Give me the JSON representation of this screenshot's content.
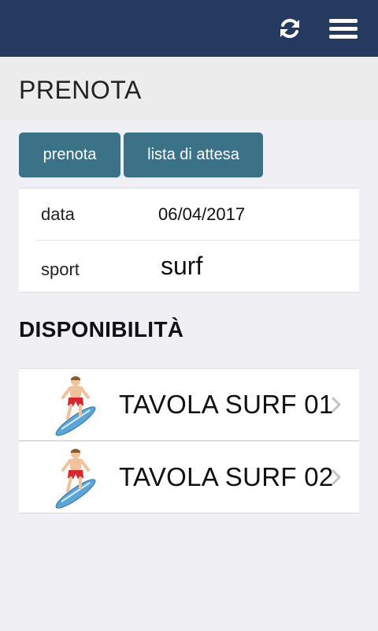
{
  "header": {
    "refresh_icon": "refresh-icon",
    "menu_icon": "hamburger-menu-icon",
    "color": "#243a5e"
  },
  "page": {
    "title": "PRENOTA"
  },
  "tabs": {
    "prenota_label": "prenota",
    "lista_label": "lista di attesa",
    "color": "#3b7288"
  },
  "info": {
    "data_label": "data",
    "data_value": "06/04/2017",
    "sport_label": "sport",
    "sport_value": "surf"
  },
  "section": {
    "title": "DISPONIBILITÀ"
  },
  "items": [
    {
      "label": "TAVOLA SURF 01",
      "icon": "surfer-icon"
    },
    {
      "label": "TAVOLA SURF 02",
      "icon": "surfer-icon"
    }
  ]
}
